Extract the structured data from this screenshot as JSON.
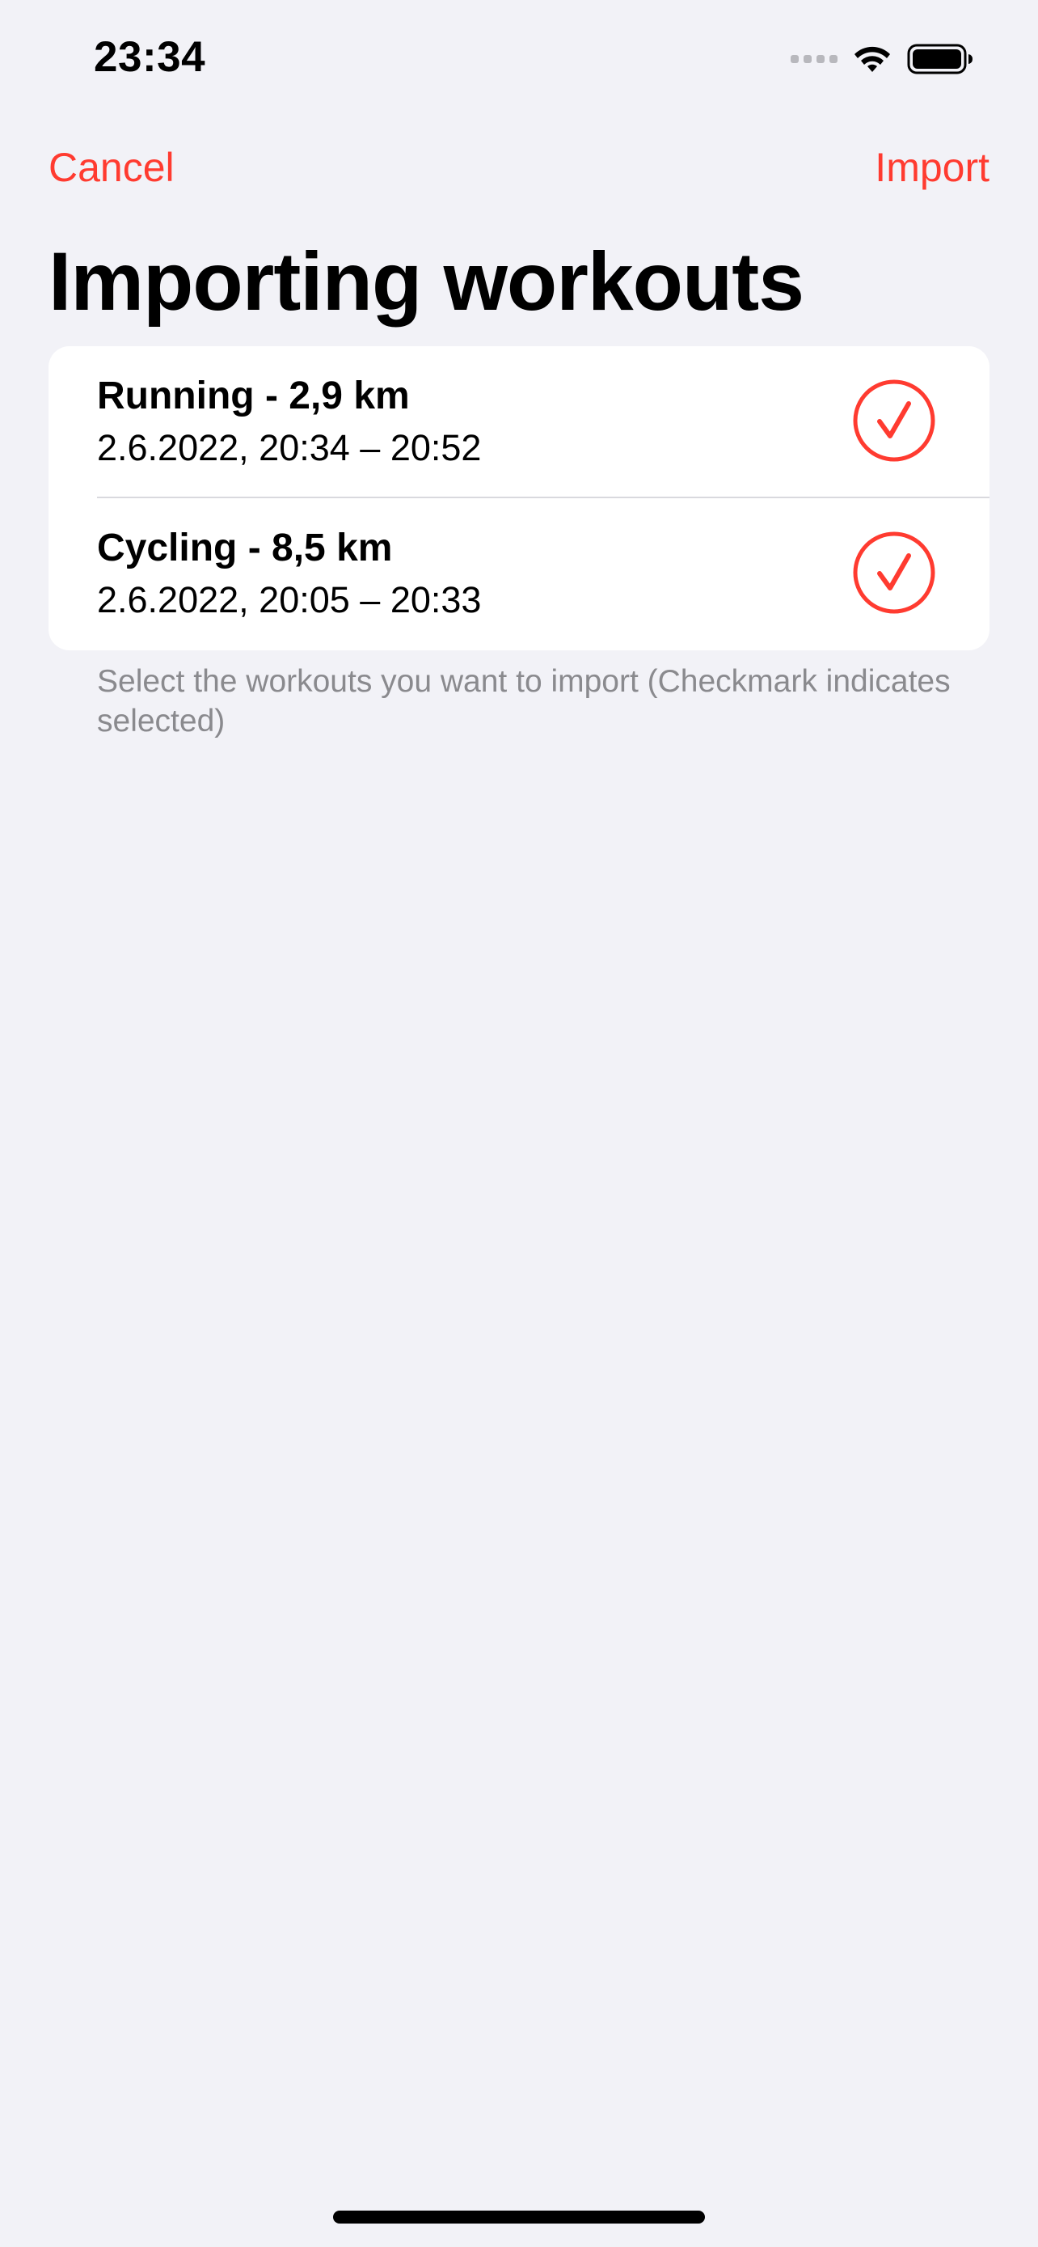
{
  "status_bar": {
    "time": "23:34",
    "icons": [
      "cellular-signal-icon",
      "wifi-icon",
      "battery-icon"
    ]
  },
  "nav": {
    "cancel_label": "Cancel",
    "import_label": "Import"
  },
  "title": "Importing workouts",
  "workouts": [
    {
      "title": "Running - 2,9 km",
      "subtitle": "2.6.2022, 20:34 – 20:52",
      "selected": true
    },
    {
      "title": "Cycling - 8,5 km",
      "subtitle": "2.6.2022, 20:05 – 20:33",
      "selected": true
    }
  ],
  "footer": "Select the workouts you want to import (Checkmark indicates selected)",
  "colors": {
    "accent": "#ff3b30",
    "background": "#f2f2f7",
    "card": "#ffffff",
    "secondary_text": "#8a8a8e"
  }
}
